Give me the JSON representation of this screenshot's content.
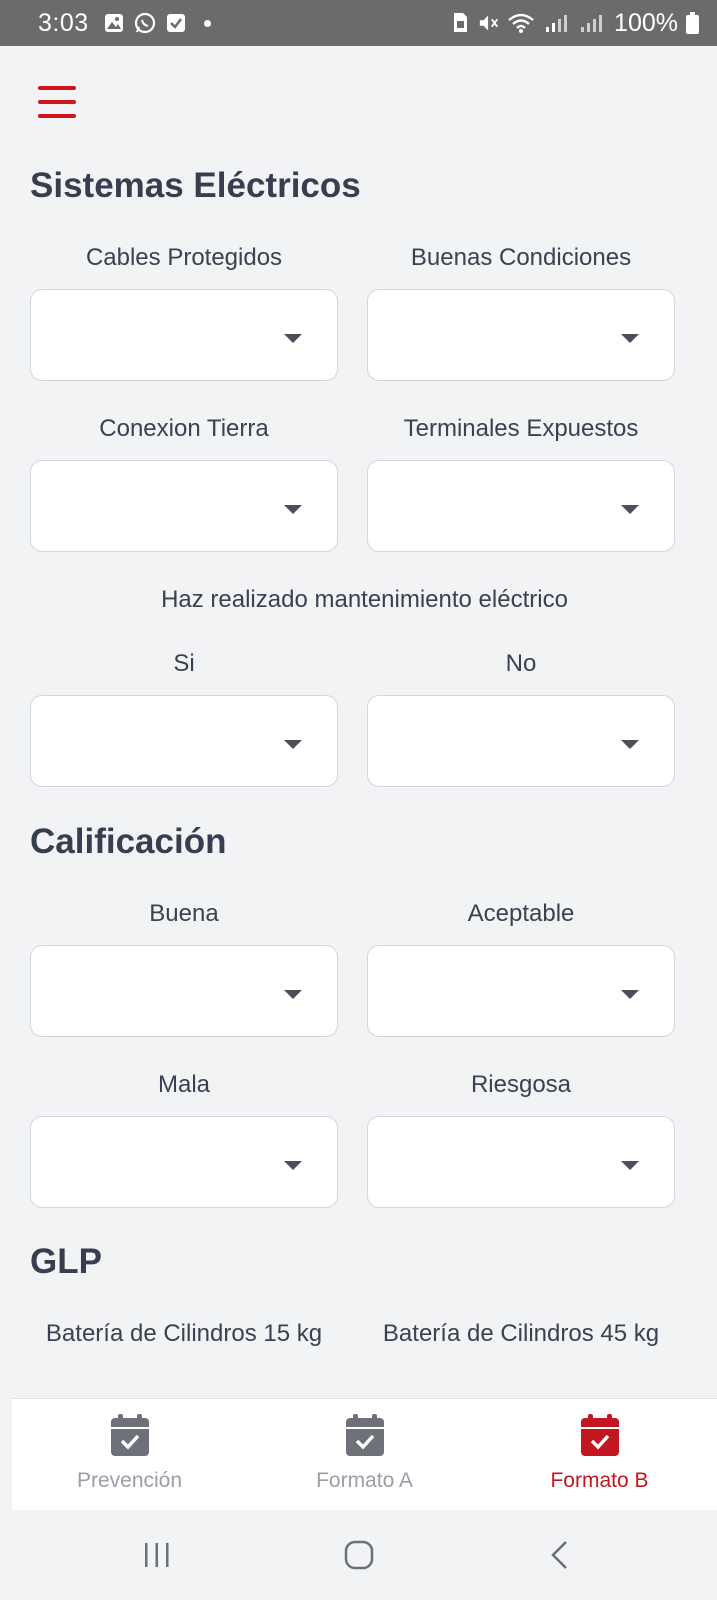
{
  "status_bar": {
    "time": "3:03",
    "battery": "100%"
  },
  "colors": {
    "accent": "#d0161d",
    "active_tab": "#c21620",
    "inactive_tab": "#9a9ea6",
    "heading": "#363e4f"
  },
  "menu": {
    "icon": "hamburger-menu-icon"
  },
  "sections": {
    "electrical": {
      "title": "Sistemas Eléctricos",
      "fields": {
        "cables_protegidos": {
          "label": "Cables Protegidos",
          "value": ""
        },
        "buenas_condiciones": {
          "label": "Buenas Condiciones",
          "value": ""
        },
        "conexion_tierra": {
          "label": "Conexion Tierra",
          "value": ""
        },
        "terminales_expuestos": {
          "label": "Terminales Expuestos",
          "value": ""
        }
      },
      "maintenance": {
        "question": "Haz realizado mantenimiento eléctrico",
        "si": {
          "label": "Si",
          "value": ""
        },
        "no": {
          "label": "No",
          "value": ""
        }
      }
    },
    "rating": {
      "title": "Calificación",
      "fields": {
        "buena": {
          "label": "Buena",
          "value": ""
        },
        "aceptable": {
          "label": "Aceptable",
          "value": ""
        },
        "mala": {
          "label": "Mala",
          "value": ""
        },
        "riesgosa": {
          "label": "Riesgosa",
          "value": ""
        }
      }
    },
    "glp": {
      "title": "GLP",
      "fields": {
        "cilindros_15": {
          "label": "Batería de Cilindros 15 kg"
        },
        "cilindros_45": {
          "label": "Batería de Cilindros 45 kg"
        }
      }
    }
  },
  "tabs": [
    {
      "label": "Prevención",
      "icon": "calendar-check-icon",
      "active": false
    },
    {
      "label": "Formato A",
      "icon": "calendar-check-icon",
      "active": false
    },
    {
      "label": "Formato B",
      "icon": "calendar-check-icon",
      "active": true
    }
  ],
  "system_nav": {
    "recents": "recents-icon",
    "home": "home-icon",
    "back": "back-icon"
  }
}
